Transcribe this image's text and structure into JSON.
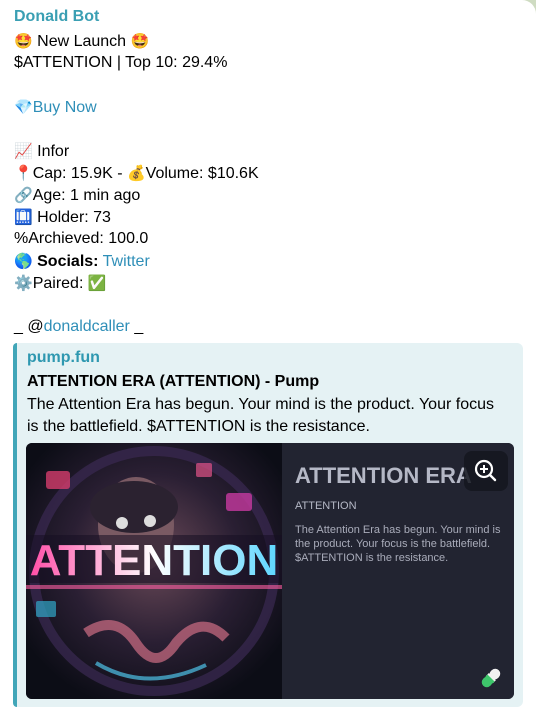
{
  "message": {
    "sender": "Donald Bot",
    "lines": {
      "launch_emoji": "🤩",
      "launch_text": " New Launch ",
      "ticker_line": "$ATTENTION | Top 10: 29.4%",
      "buy_emoji": "💎",
      "buy_link": "Buy Now",
      "infor_emoji": "📈",
      "infor_text": " Infor",
      "cap_emoji": "📍",
      "cap_text": "Cap: 15.9K - ",
      "volume_emoji": "💰",
      "volume_text": "Volume: $10.6K",
      "age_emoji": "🔗",
      "age_text": "Age: 1 min ago",
      "holder_emoji": "🛄",
      "holder_text": " Holder: 73",
      "archieved_text": "%Archieved: 100.0",
      "socials_emoji": "🌎",
      "socials_label": " Socials:",
      "socials_link": " Twitter",
      "paired_emoji": "⚙️",
      "paired_text": "Paired: ",
      "paired_check": "✅",
      "caller_prefix": "_ @",
      "caller_link": "donaldcaller",
      "caller_suffix": " _"
    }
  },
  "preview": {
    "site": "pump.fun",
    "title": "ATTENTION ERA (ATTENTION) - Pump",
    "description": "The Attention Era has begun. Your mind is the product. Your focus is the battlefield. $ATTENTION is the resistance.",
    "card": {
      "title": "ATTENTION ERA",
      "ticker": "ATTENTION",
      "description": "The Attention Era has begun. Your mind is the product. Your focus is the battlefield. $ATTENTION is the resistance."
    },
    "art_text": "ATTENTION"
  },
  "colors": {
    "accent": "#3a9fb3",
    "link": "#2f8fb8",
    "preview_bg": "#e5f2f4",
    "card_bg": "#222431"
  }
}
